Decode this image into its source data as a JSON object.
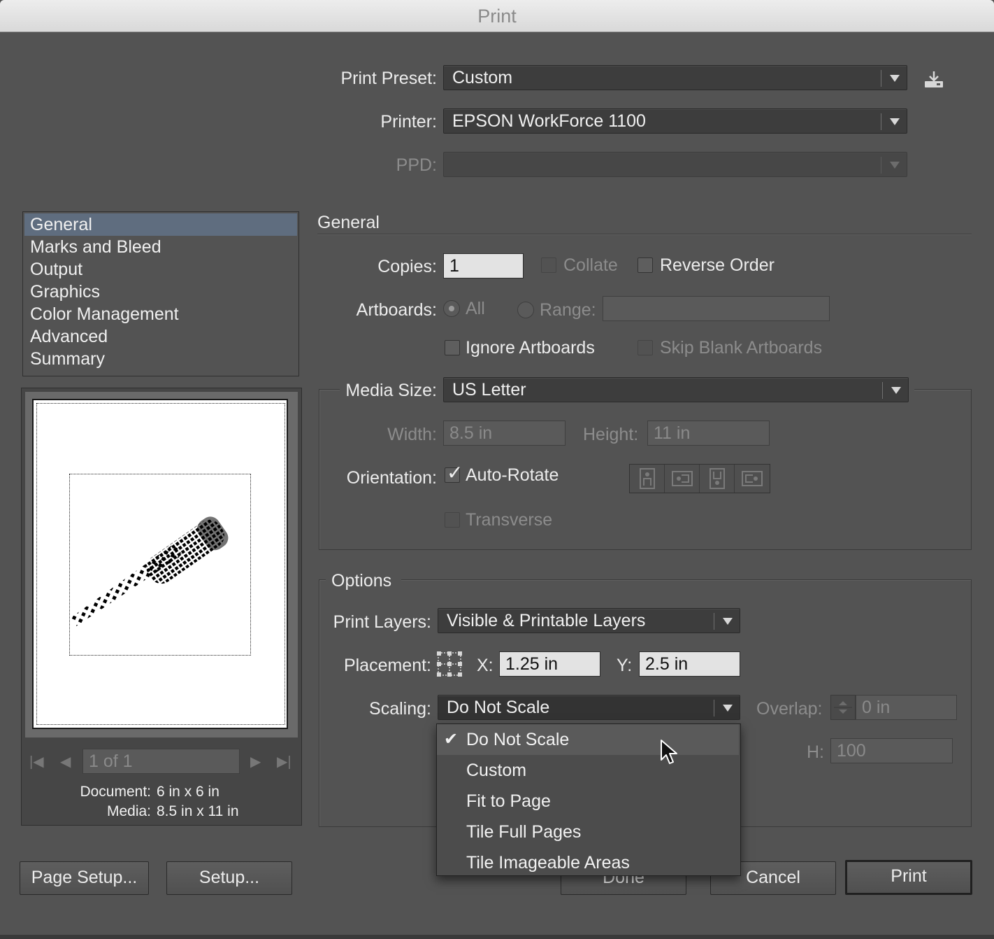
{
  "window": {
    "title": "Print"
  },
  "top": {
    "print_preset_label": "Print Preset:",
    "print_preset_value": "Custom",
    "printer_label": "Printer:",
    "printer_value": "EPSON WorkForce 1100",
    "ppd_label": "PPD:",
    "ppd_value": ""
  },
  "sidebar": {
    "items": [
      {
        "label": "General",
        "selected": true
      },
      {
        "label": "Marks and Bleed"
      },
      {
        "label": "Output"
      },
      {
        "label": "Graphics"
      },
      {
        "label": "Color Management"
      },
      {
        "label": "Advanced"
      },
      {
        "label": "Summary"
      }
    ]
  },
  "preview": {
    "page_field": "1 of 1",
    "document_label": "Document:",
    "document_value": "6 in x 6 in",
    "media_label": "Media:",
    "media_value": "8.5 in x 11 in"
  },
  "general": {
    "section_title": "General",
    "copies_label": "Copies:",
    "copies_value": "1",
    "collate_label": "Collate",
    "reverse_order_label": "Reverse Order",
    "artboards_label": "Artboards:",
    "all_label": "All",
    "range_label": "Range:",
    "range_value": "",
    "ignore_artboards_label": "Ignore Artboards",
    "skip_blank_label": "Skip Blank Artboards"
  },
  "media": {
    "media_size_label": "Media Size:",
    "media_size_value": "US Letter",
    "width_label": "Width:",
    "width_value": "8.5 in",
    "height_label": "Height:",
    "height_value": "11 in",
    "orientation_label": "Orientation:",
    "auto_rotate_label": "Auto-Rotate",
    "transverse_label": "Transverse"
  },
  "options": {
    "section_title": "Options",
    "print_layers_label": "Print Layers:",
    "print_layers_value": "Visible & Printable Layers",
    "placement_label": "Placement:",
    "x_label": "X:",
    "x_value": "1.25 in",
    "y_label": "Y:",
    "y_value": "2.5 in",
    "scaling_label": "Scaling:",
    "scaling_value": "Do Not Scale",
    "overlap_label": "Overlap:",
    "overlap_value": "0 in",
    "h_label": "H:",
    "h_value": "100"
  },
  "scaling_menu": {
    "items": [
      {
        "label": "Do Not Scale",
        "checked": true
      },
      {
        "label": "Custom"
      },
      {
        "label": "Fit to Page"
      },
      {
        "label": "Tile Full Pages"
      },
      {
        "label": "Tile Imageable Areas"
      }
    ]
  },
  "buttons": {
    "page_setup": "Page Setup...",
    "setup": "Setup...",
    "done": "Done",
    "cancel": "Cancel",
    "print": "Print"
  }
}
